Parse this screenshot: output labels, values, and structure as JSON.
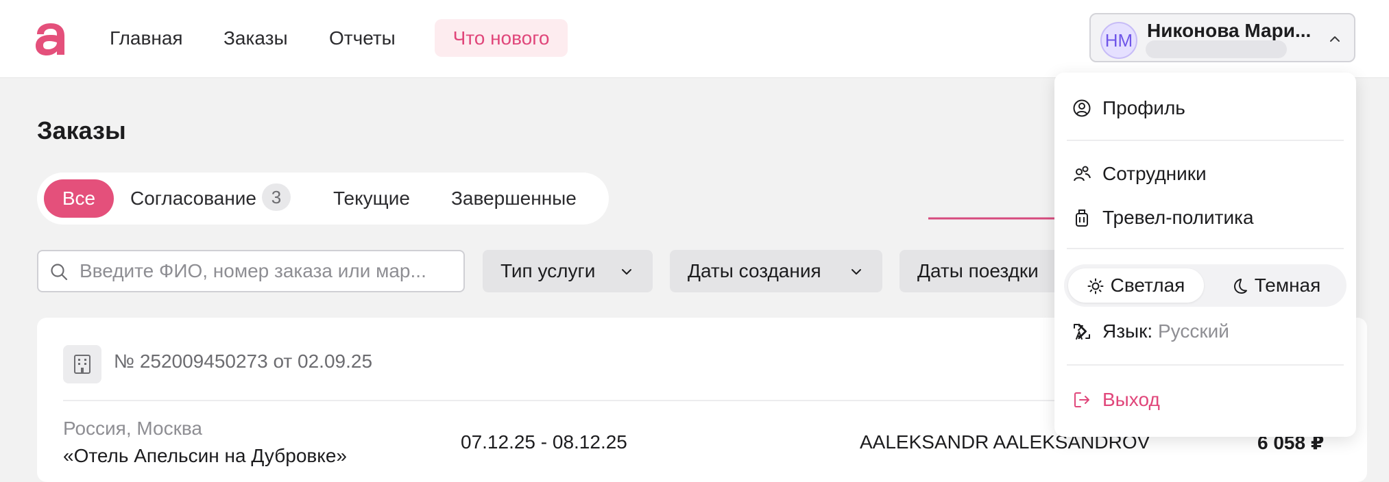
{
  "header": {
    "nav": {
      "main": "Главная",
      "orders": "Заказы",
      "reports": "Отчеты",
      "whats_new": "Что нового"
    },
    "user": {
      "initials": "НМ",
      "name": "Никонова Мари..."
    }
  },
  "page": {
    "title": "Заказы",
    "tabs": {
      "all": "Все",
      "approval": "Согласование",
      "approval_count": "3",
      "current": "Текущие",
      "completed": "Завершенные"
    },
    "search": {
      "placeholder": "Введите ФИО, номер заказа или мар..."
    },
    "filters": {
      "service_type": "Тип услуги",
      "creation_dates": "Даты создания",
      "trip_dates": "Даты поездки"
    },
    "order": {
      "number": "№ 252009450273 от 02.09.25",
      "city": "Россия, Москва",
      "hotel": "«Отель Апельсин на Дубровке»",
      "dates": "07.12.25 - 08.12.25",
      "traveler": "AALEKSANDR AALEKSANDROV",
      "price": "6 058 ₽"
    }
  },
  "menu": {
    "profile": "Профиль",
    "employees": "Сотрудники",
    "travel_policy": "Тревел-политика",
    "theme_light": "Светлая",
    "theme_dark": "Темная",
    "language_label": "Язык:",
    "language_value": "Русский",
    "logout": "Выход"
  },
  "colors": {
    "accent": "#e4507b",
    "accent_text": "#e0467a",
    "accent_bg": "#fdecef",
    "avatar_bg": "#e5e0ff",
    "avatar_text": "#6f56e8"
  }
}
